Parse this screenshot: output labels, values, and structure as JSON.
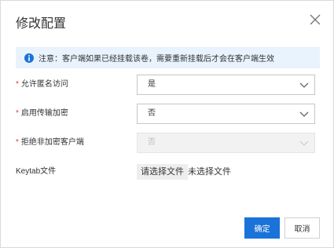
{
  "dialog": {
    "title": "修改配置",
    "close_icon": "close-icon"
  },
  "notice": {
    "icon": "info-icon",
    "text": "注意：客户端如果已经挂载该卷，需要重新挂载后才会在客户端生效"
  },
  "form": {
    "required_mark": "*",
    "anonymous_access": {
      "label": "允许匿名访问",
      "value": "是"
    },
    "transfer_encryption": {
      "label": "启用传输加密",
      "value": "否"
    },
    "reject_unencrypted": {
      "label": "拒绝非加密客户端",
      "value": "否",
      "disabled": true
    },
    "keytab": {
      "label": "Keytab文件",
      "button_label": "请选择文件",
      "status": "未选择文件"
    }
  },
  "footer": {
    "ok_label": "确定",
    "cancel_label": "取消"
  },
  "colors": {
    "primary": "#1a73d9",
    "required": "#e53935",
    "notice_bg": "#e8f3fd",
    "info_icon": "#1a73d9"
  }
}
